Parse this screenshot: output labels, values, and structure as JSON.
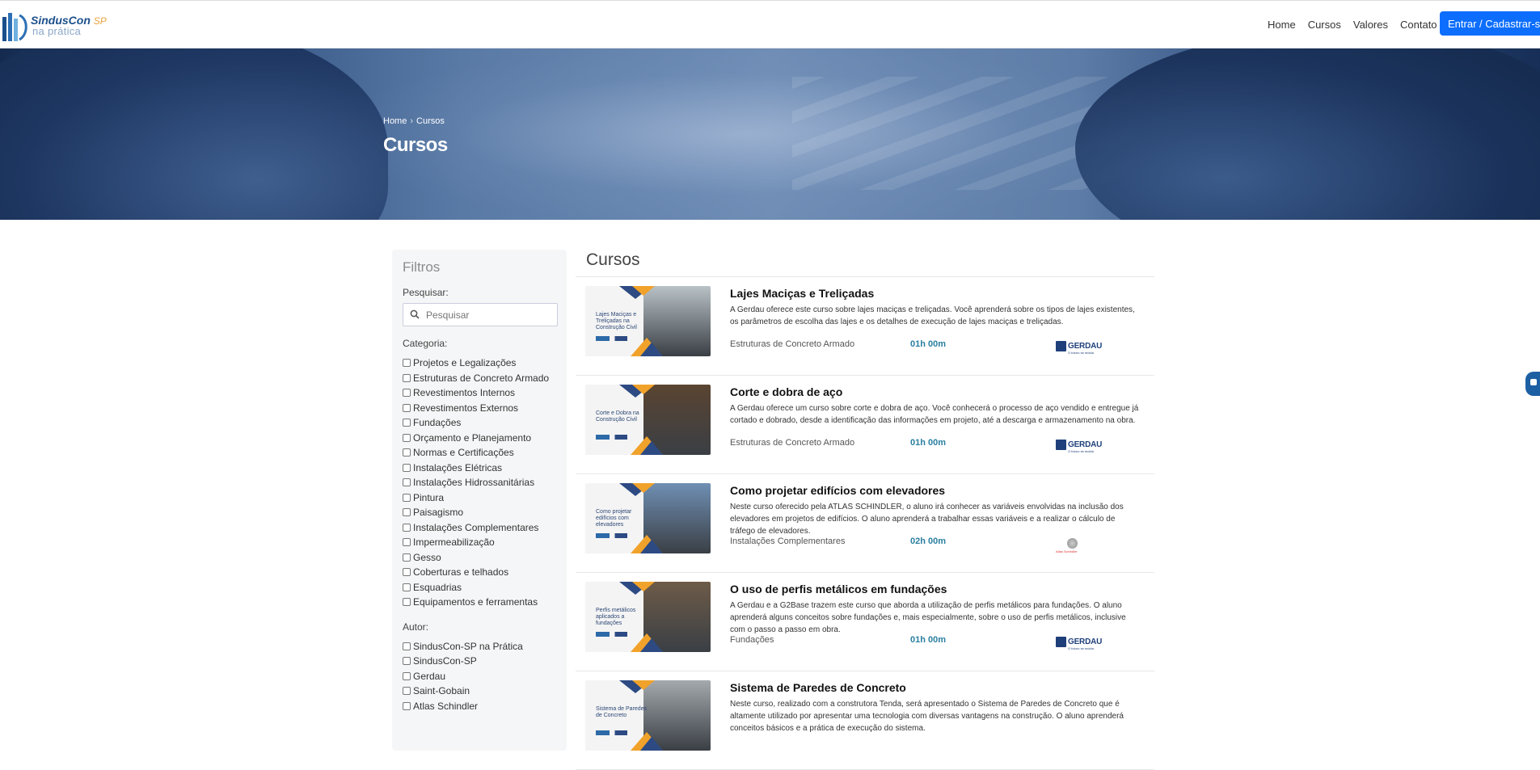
{
  "header": {
    "logo": {
      "brand": "SindusCon",
      "region": "SP",
      "tagline": "na prática"
    },
    "nav": [
      "Home",
      "Cursos",
      "Valores",
      "Contato"
    ],
    "cta_label": "Entrar / Cadastrar-se"
  },
  "hero": {
    "breadcrumb": [
      "Home",
      "Cursos"
    ],
    "title": "Cursos"
  },
  "sidebar": {
    "title": "Filtros",
    "search_label": "Pesquisar:",
    "search_placeholder": "Pesquisar",
    "category_label": "Categoria:",
    "categories": [
      "Projetos e Legalizações",
      "Estruturas de Concreto Armado",
      "Revestimentos Internos",
      "Revestimentos Externos",
      "Fundações",
      "Orçamento e Planejamento",
      "Normas e Certificações",
      "Instalações Elétricas",
      "Instalações Hidrossanitárias",
      "Pintura",
      "Paisagismo",
      "Instalações Complementares",
      "Impermeabilização",
      "Gesso",
      "Coberturas e telhados",
      "Esquadrias",
      "Equipamentos e ferramentas"
    ],
    "author_label": "Autor:",
    "authors": [
      "SindusCon-SP na Prática",
      "SindusCon-SP",
      "Gerdau",
      "Saint-Gobain",
      "Atlas Schindler"
    ]
  },
  "main": {
    "title": "Cursos",
    "courses": [
      {
        "title": "Lajes Maciças e Treliçadas",
        "description": "A Gerdau oferece este curso sobre lajes maciças e treliçadas. Você aprenderá sobre os tipos de lajes existentes, os parâmetros de escolha das lajes e os detalhes de execução de lajes maciças e treliçadas.",
        "category": "Estruturas de Concreto Armado",
        "duration": "01h 00m",
        "thumb_text": "Lajes Maciças e Treliçadas na Construção Civil",
        "logo": "GERDAU",
        "logo_sub": "O futuro se molda",
        "photo_color": "#b9c2c7"
      },
      {
        "title": "Corte e dobra de aço",
        "description": "A Gerdau oferece um curso sobre corte e dobra de aço. Você conhecerá o processo de aço vendido e entregue já cortado e dobrado, desde a identificação das informações em projeto, até a descarga e armazenamento na obra.",
        "category": "Estruturas de Concreto Armado",
        "duration": "01h 00m",
        "thumb_text": "Corte e Dobra na Construção Civil",
        "logo": "GERDAU",
        "logo_sub": "O futuro se molda",
        "photo_color": "#5a4431"
      },
      {
        "title": "Como projetar edifícios com elevadores",
        "description": "Neste curso oferecido pela ATLAS SCHINDLER, o aluno irá conhecer as variáveis envolvidas na inclusão dos elevadores em projetos de edifícios. O aluno aprenderá a trabalhar essas variáveis e a realizar o cálculo de tráfego de elevadores.",
        "category": "Instalações Complementares",
        "duration": "02h 00m",
        "thumb_text": "Como projetar edifícios com elevadores",
        "logo": "Atlas Schindler",
        "logo_sub": "",
        "photo_color": "#6f8fb3"
      },
      {
        "title": "O uso de perfis metálicos em fundações",
        "description": "A Gerdau e a G2Base trazem este curso que aborda a utilização de perfis metálicos para fundações. O aluno aprenderá alguns conceitos sobre fundações e, mais especialmente, sobre o uso de perfis metálicos, inclusive com o passo a passo em obra.",
        "category": "Fundações",
        "duration": "01h 00m",
        "thumb_text": "Perfis metálicos aplicados a fundações",
        "logo": "GERDAU",
        "logo_sub": "O futuro se molda",
        "photo_color": "#6d5b48"
      },
      {
        "title": "Sistema de Paredes de Concreto",
        "description": "Neste curso, realizado com a construtora Tenda, será apresentado o Sistema de Paredes de Concreto que é altamente utilizado por apresentar uma tecnologia com diversas vantagens na construção. O aluno aprenderá conceitos básicos e a prática de execução do sistema.",
        "category": "",
        "duration": "",
        "thumb_text": "Sistema de Paredes de Concreto",
        "logo": "",
        "logo_sub": "",
        "photo_color": "#a4a9ae"
      }
    ]
  },
  "colors": {
    "primary": "#0d6efd",
    "duration": "#2a7fa0",
    "gerdau": "#1f3f7a",
    "accent_orange": "#f1a22a"
  }
}
